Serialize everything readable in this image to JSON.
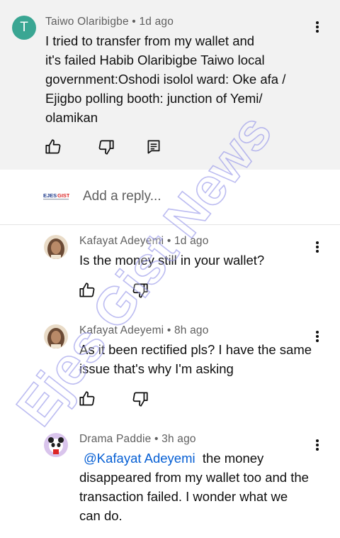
{
  "parent_comment": {
    "avatar_letter": "T",
    "author": "Taiwo Olaribigbe",
    "time": "1d ago",
    "text_lines": [
      "I tried to transfer  from my wallet and",
      "it's failed Habib Olaribigbe  Taiwo local",
      "government:Oshodi isolol ward: Oke afa /",
      "Ejigbo polling booth: junction of Yemi/",
      "olamikan"
    ]
  },
  "reply_input": {
    "placeholder": "Add a reply...",
    "channel_logo_text": "EJESGIST"
  },
  "replies": [
    {
      "author": "Kafayat Adeyemi",
      "time": "1d ago",
      "text_lines": [
        "Is the money still in your wallet?"
      ]
    },
    {
      "author": "Kafayat Adeyemi",
      "time": "8h ago",
      "text_lines": [
        "As it been rectified pls? I have the same",
        "issue that's why I'm asking"
      ]
    },
    {
      "author": "Drama Paddie",
      "time": "3h ago",
      "mention": "@Kafayat Adeyemi",
      "text_first_rest": "  the money",
      "text_lines": [
        "disappeared from my wallet too and the",
        "transaction failed. I wonder what we",
        "can do."
      ]
    }
  ],
  "meta_separator": " • ",
  "watermark": "Ejes Gist News",
  "colors": {
    "parent_bg": "#f2f2f2",
    "avatar_letter_bg": "#3aa693",
    "mention": "#065fd4",
    "watermark": "#8f8fe8"
  }
}
